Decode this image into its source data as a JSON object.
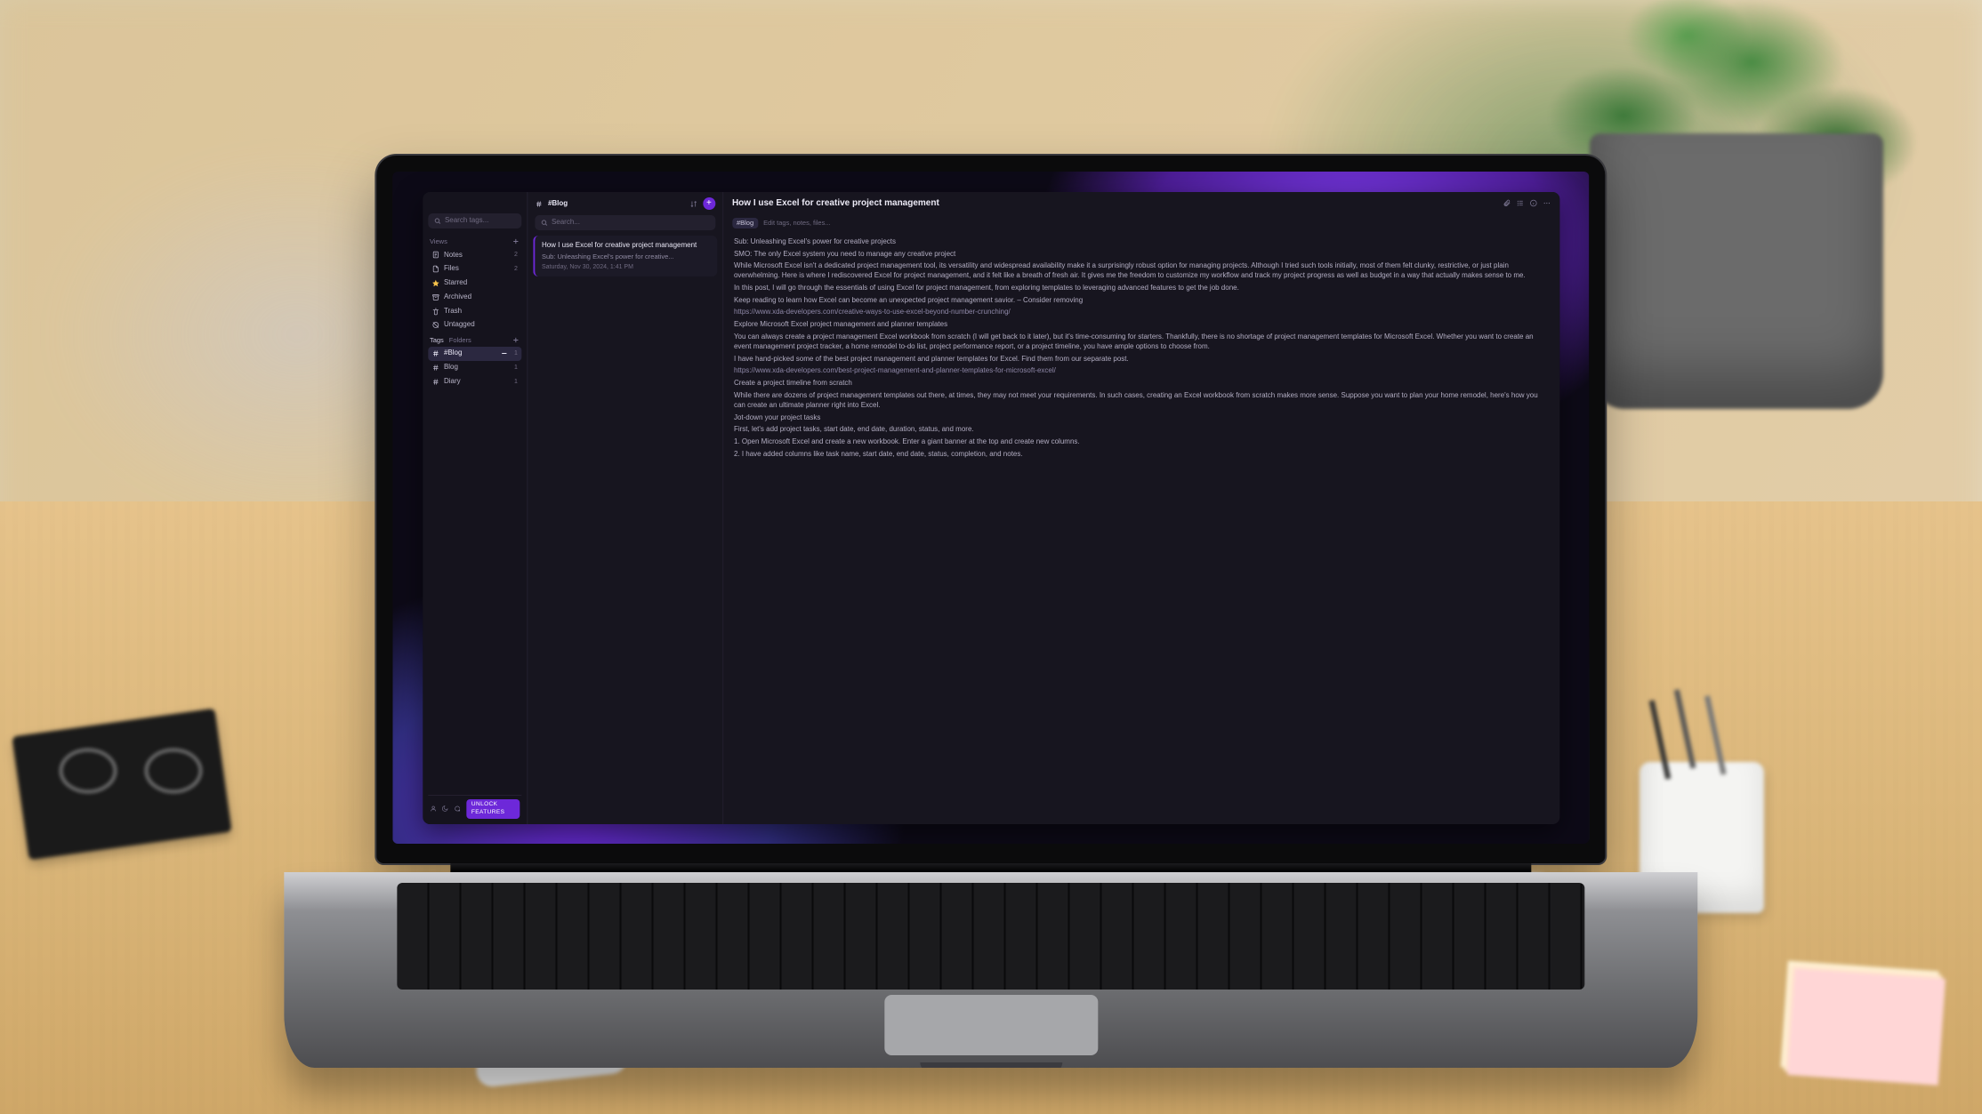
{
  "sidebar": {
    "search_placeholder": "Search tags...",
    "section_views": "Views",
    "views": [
      {
        "icon": "note",
        "label": "Notes",
        "count": "2"
      },
      {
        "icon": "file",
        "label": "Files",
        "count": "2"
      },
      {
        "icon": "star",
        "label": "Starred",
        "count": ""
      },
      {
        "icon": "archive",
        "label": "Archived",
        "count": ""
      },
      {
        "icon": "trash",
        "label": "Trash",
        "count": ""
      },
      {
        "icon": "untagged",
        "label": "Untagged",
        "count": ""
      }
    ],
    "tabs": {
      "tags": "Tags",
      "folders": "Folders"
    },
    "tags": [
      {
        "label": "#Blog",
        "count": "1",
        "active": true
      },
      {
        "label": "Blog",
        "count": "1",
        "active": false
      },
      {
        "label": "Diary",
        "count": "1",
        "active": false
      }
    ],
    "unlock_label": "UNLOCK FEATURES"
  },
  "middle": {
    "title": "#Blog",
    "search_placeholder": "Search...",
    "note": {
      "title": "How I use Excel for creative project management",
      "subtitle": "Sub: Unleashing Excel's power for creative...",
      "date": "Saturday, Nov 30, 2024, 1:41 PM"
    }
  },
  "editor": {
    "title": "How I use Excel for creative project management",
    "tag": "#Blog",
    "tag_hint": "Edit tags, notes, files...",
    "body": {
      "l0": "Sub: Unleashing Excel's power for creative projects",
      "l1": "SMO: The only Excel system you need to manage any creative project",
      "l2": "While Microsoft Excel isn't a dedicated project management tool, its versatility and widespread availability make it a surprisingly robust option for managing projects. Although I tried such tools initially, most of them felt clunky, restrictive, or just plain overwhelming. Here is where I rediscovered Excel for project management, and it felt like a breath of fresh air. It gives me the freedom to customize my workflow and track my project progress as well as budget in a way that actually makes sense to me.",
      "l3": "In this post, I will go through the essentials of using Excel for project management, from exploring templates to leveraging advanced features to get the job done.",
      "l4": "Keep reading to learn how Excel can become an unexpected project management savior. – Consider removing",
      "l5": "https://www.xda-developers.com/creative-ways-to-use-excel-beyond-number-crunching/",
      "l6": "Explore Microsoft Excel project management and planner templates",
      "l7": "You can always create a project management Excel workbook from scratch (I will get back to it later), but it's time-consuming for starters. Thankfully, there is no shortage of project management templates for Microsoft Excel. Whether you want to create an event management project tracker, a home remodel to-do list, project performance report, or a project timeline, you have ample options to choose from.",
      "l8": "I have hand-picked some of the best project management and planner templates for Excel. Find them from our separate post.",
      "l9": "https://www.xda-developers.com/best-project-management-and-planner-templates-for-microsoft-excel/",
      "l10": "Create a project timeline from scratch",
      "l11": "While there are dozens of project management templates out there, at times, they may not meet your requirements. In such cases, creating an Excel workbook from scratch makes more sense. Suppose you want to plan your home remodel, here's how you can create an ultimate planner right into Excel.",
      "l12": "Jot-down your project tasks",
      "l13": "First, let's add project tasks, start date, end date, duration, status, and more.",
      "l14": "1. Open Microsoft Excel and create a new workbook. Enter a giant banner at the top and create new columns.",
      "l15": "2. I have added columns like task name, start date, end date, status, completion, and notes."
    }
  }
}
